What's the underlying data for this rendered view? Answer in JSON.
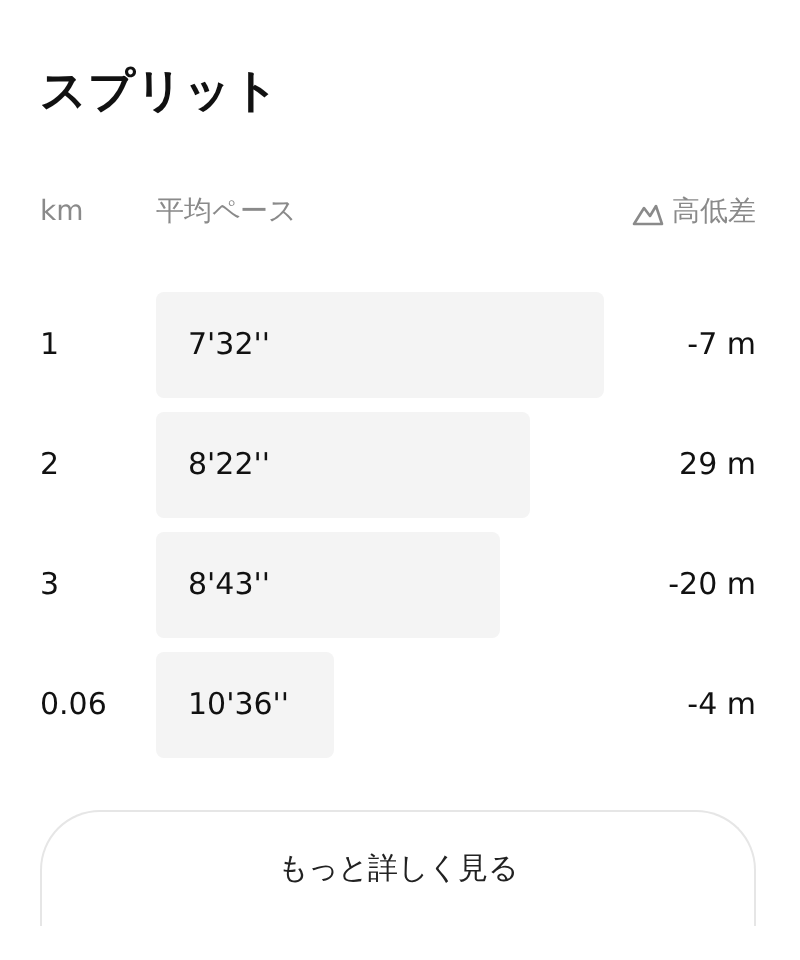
{
  "title": "スプリット",
  "columns": {
    "distance": "km",
    "pace": "平均ペース",
    "elevation": "高低差"
  },
  "splits": [
    {
      "distance": "1",
      "pace": "7'32''",
      "elevation": "-7 m"
    },
    {
      "distance": "2",
      "pace": "8'22''",
      "elevation": "29 m"
    },
    {
      "distance": "3",
      "pace": "8'43''",
      "elevation": "-20 m"
    },
    {
      "distance": "0.06",
      "pace": "10'36''",
      "elevation": "-4 m"
    }
  ],
  "button": "もっと詳しく見る"
}
